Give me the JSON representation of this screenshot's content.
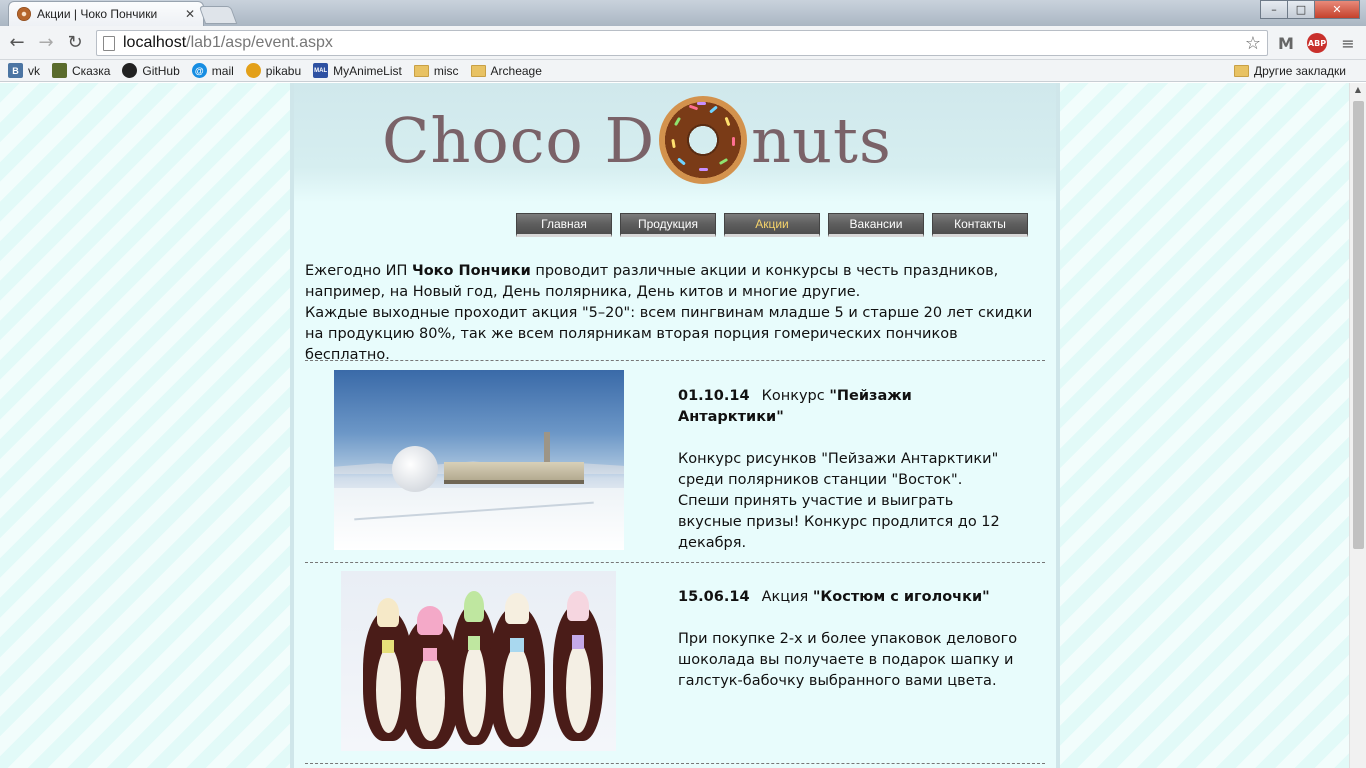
{
  "browser": {
    "tab_title": "Акции | Чоко Пончики",
    "tab_close": "✕",
    "url_host": "localhost",
    "url_path": "/lab1/asp/event.aspx",
    "window_buttons": {
      "minimize": "–",
      "maximize": "□",
      "close": "✕"
    },
    "nav": {
      "back": "←",
      "forward": "→",
      "reload": "↻"
    },
    "star": "☆",
    "abp_label": "ABP",
    "gmail_label": "M",
    "menu_label": "≡",
    "bookmarks": [
      {
        "label": "vk",
        "icon": "vk-icon",
        "glyph": "B"
      },
      {
        "label": "Сказка",
        "icon": "skazka-icon",
        "glyph": ""
      },
      {
        "label": "GitHub",
        "icon": "github-icon",
        "glyph": ""
      },
      {
        "label": "mail",
        "icon": "mail-icon",
        "glyph": "@"
      },
      {
        "label": "pikabu",
        "icon": "pikabu-icon",
        "glyph": ""
      },
      {
        "label": "MyAnimeList",
        "icon": "myanimelist-icon",
        "glyph": "MAL"
      },
      {
        "label": "misc",
        "icon": "folder-icon",
        "glyph": ""
      },
      {
        "label": "Archeage",
        "icon": "folder-icon",
        "glyph": ""
      }
    ],
    "other_bookmarks": "Другие закладки"
  },
  "site": {
    "logo_left": "Choco D",
    "logo_right": "nuts",
    "menu": [
      {
        "label": "Главная",
        "active": false
      },
      {
        "label": "Продукция",
        "active": false
      },
      {
        "label": "Акции",
        "active": true
      },
      {
        "label": "Вакансии",
        "active": false
      },
      {
        "label": "Контакты",
        "active": false
      }
    ],
    "intro": {
      "part1": "Ежегодно ИП ",
      "company": "Чоко Пончики",
      "part2": " проводит различные акции и конкурсы в честь праздников, например, на Новый год, День полярника, День китов и многие другие.",
      "part3": "Каждые выходные проходит акция \"5–20\": всем пингвинам младше 5 и старше 20 лет скидки на продукцию 80%, так же всем полярникам вторая порция гомерических пончиков бесплатно."
    },
    "events": [
      {
        "date": "01.10.14",
        "kind": "Конкурс ",
        "title": "\"Пейзажи Антарктики\"",
        "text": "Конкурс рисунков \"Пейзажи Антарктики\" среди полярников станции \"Восток\". Спеши принять участие и выиграть вкусные призы! Конкурс продлится до 12 декабря."
      },
      {
        "date": "15.06.14",
        "kind": "Акция ",
        "title": "\"Костюм с иголочки\"",
        "text": "При покупке 2-х и более упаковок делового шоколада вы получаете в подарок шапку и галстук-бабочку выбранного вами цвета."
      }
    ]
  },
  "colors": {
    "accent_active_menu": "#f5d36b",
    "page_bg": "#e8fcfc",
    "menu_bg": "#5e5e5e"
  }
}
